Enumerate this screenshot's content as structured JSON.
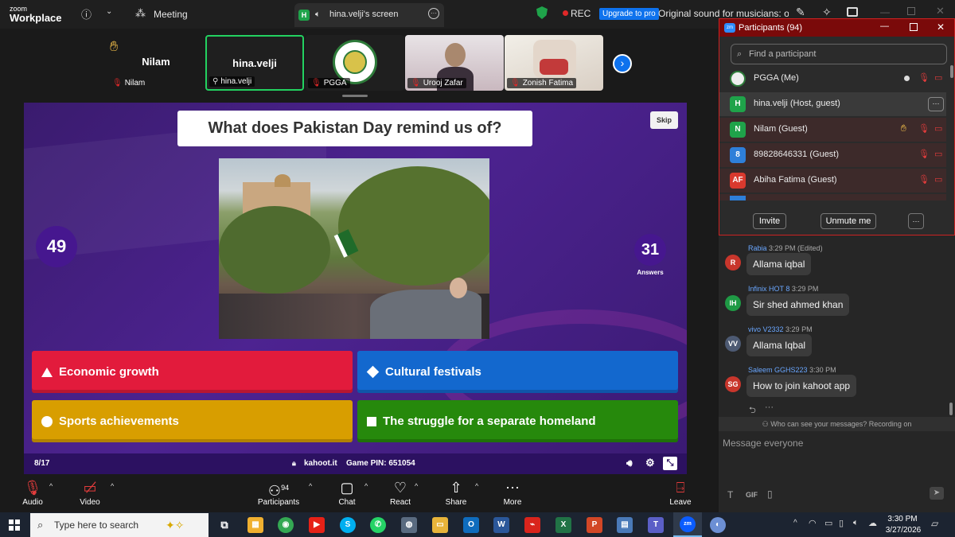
{
  "topbar": {
    "logo_line1": "zoom",
    "logo_line2": "Workplace",
    "meeting_label": "Meeting",
    "share_badge": "H",
    "share_tab_label": "hina.velji's screen",
    "rec_label": "REC",
    "upgrade_label": "Upgrade to pro",
    "sound_label": "Original sound for musicians: on"
  },
  "strip": {
    "tiles": [
      {
        "big": "Nilam",
        "label": "Nilam"
      },
      {
        "big": "hina.velji",
        "label": "hina.velji"
      },
      {
        "label": "PGGA"
      },
      {
        "label": "Urooj Zafar"
      },
      {
        "label": "Zonish Fatima"
      }
    ]
  },
  "kahoot": {
    "question": "What does Pakistan Day remind us of?",
    "skip": "Skip",
    "timer": "49",
    "answers_count": "31",
    "answers_label": "Answers",
    "options": [
      {
        "label": "Economic growth",
        "color": "#e21b3c",
        "shape": "triangle"
      },
      {
        "label": "Cultural festivals",
        "color": "#1368ce",
        "shape": "diamond"
      },
      {
        "label": "Sports achievements",
        "color": "#d89e00",
        "shape": "circle"
      },
      {
        "label": "The struggle for a separate homeland",
        "color": "#26890c",
        "shape": "square"
      }
    ],
    "progress": "8/17",
    "site": "kahoot.it",
    "pin_label": "Game PIN: 651054"
  },
  "participants": {
    "title": "Participants (94)",
    "search_placeholder": "Find a participant",
    "rows": [
      {
        "initials": "",
        "name": "PGGA (Me)",
        "color": "#eeeeee"
      },
      {
        "initials": "H",
        "name": "hina.velji (Host, guest)",
        "color": "#1fa34a"
      },
      {
        "initials": "N",
        "name": "Nilam (Guest)",
        "color": "#1fa34a"
      },
      {
        "initials": "8",
        "name": "89828646331 (Guest)",
        "color": "#2e7fd9"
      },
      {
        "initials": "AF",
        "name": "Abiha Fatima (Guest)",
        "color": "#d9392e"
      }
    ],
    "invite_label": "Invite",
    "unmute_label": "Unmute me"
  },
  "chat": {
    "messages": [
      {
        "initials": "R",
        "sender": "Rabia",
        "time": "3:29 PM (Edited)",
        "text": "Allama iqbal",
        "color": "#c8362c"
      },
      {
        "initials": "IH",
        "sender": "Infinix HOT 8",
        "time": "3:29 PM",
        "text": "Sir shed ahmed khan",
        "color": "#1f9a45"
      },
      {
        "initials": "VV",
        "sender": "vivo V2332",
        "time": "3:29 PM",
        "text": "Allama Iqbal",
        "color": "#4d5a73"
      },
      {
        "initials": "SG",
        "sender": "Saleem GGHS223",
        "time": "3:30 PM",
        "text": "How to join kahoot app",
        "color": "#c8362c"
      }
    ],
    "visibility_note": "Who can see your messages? Recording on",
    "input_placeholder": "Message everyone",
    "gif_label": "GIF"
  },
  "controls": {
    "audio": "Audio",
    "video": "Video",
    "participants": "Participants",
    "participants_count": "94",
    "chat": "Chat",
    "react": "React",
    "share": "Share",
    "more": "More",
    "leave": "Leave"
  },
  "taskbar": {
    "search_placeholder": "Type here to search",
    "time": "3:30 PM",
    "date": "3/27/2026"
  }
}
